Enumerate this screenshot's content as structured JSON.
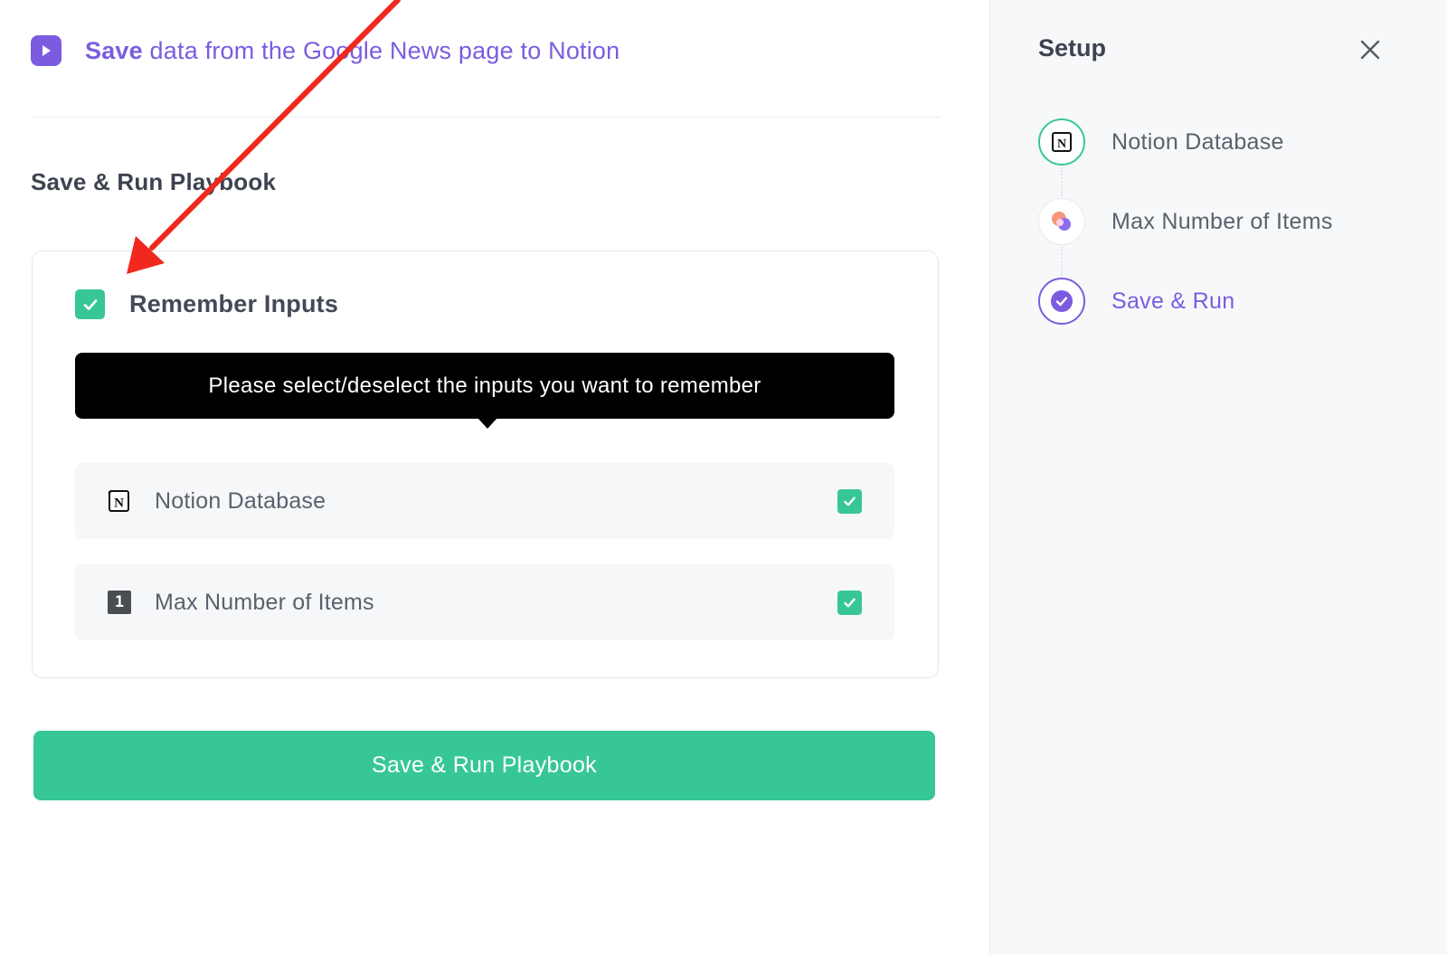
{
  "header": {
    "title_bold": "Save",
    "title_rest": " data from the Google News page to Notion",
    "icon": "play-icon"
  },
  "main": {
    "section_title": "Save & Run Playbook",
    "remember": {
      "label": "Remember Inputs",
      "checked": true
    },
    "tooltip": "Please select/deselect the inputs you want to remember",
    "inputs": [
      {
        "label": "Notion Database",
        "icon": "notion-icon",
        "checked": true
      },
      {
        "label": "Max Number of Items",
        "icon": "number-one-icon",
        "icon_text": "1",
        "checked": true
      }
    ],
    "primary_button": "Save & Run Playbook"
  },
  "sidebar": {
    "title": "Setup",
    "close_icon": "close-icon",
    "steps": [
      {
        "label": "Notion Database",
        "icon": "notion-icon",
        "state": "done"
      },
      {
        "label": "Max Number of Items",
        "icon": "colorful-blob-icon",
        "state": "done"
      },
      {
        "label": "Save & Run",
        "icon": "check-circle-icon",
        "state": "active"
      }
    ]
  },
  "colors": {
    "accent": "#7b5ce0",
    "success": "#37c796",
    "tooltip_bg": "#000000",
    "annotation_arrow": "#f0281e"
  }
}
